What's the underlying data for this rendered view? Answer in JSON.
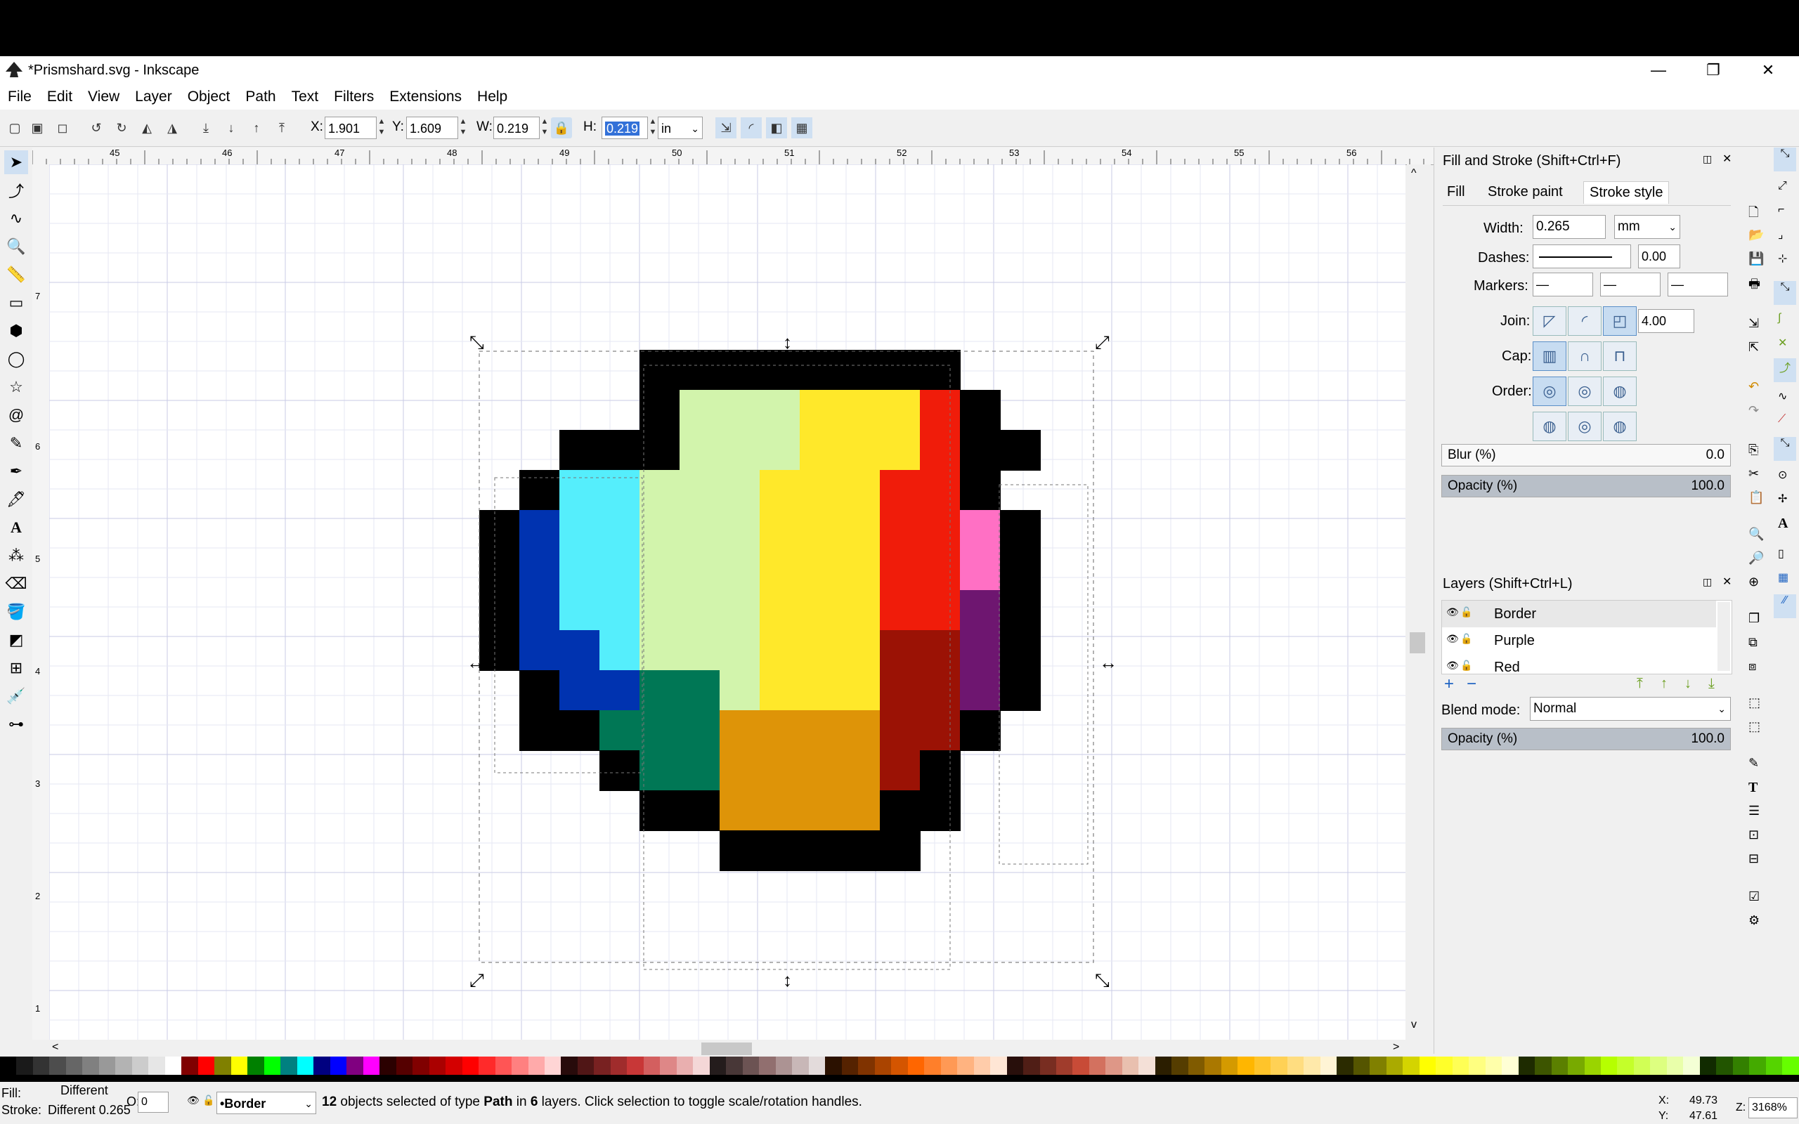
{
  "window": {
    "title": "*Prismshard.svg - Inkscape",
    "minimize_glyph": "—",
    "restore_glyph": "❐",
    "close_glyph": "✕"
  },
  "menu": [
    "File",
    "Edit",
    "View",
    "Layer",
    "Object",
    "Path",
    "Text",
    "Filters",
    "Extensions",
    "Help"
  ],
  "toolbar": {
    "x_label": "X:",
    "x_value": "1.901",
    "y_label": "Y:",
    "y_value": "1.609",
    "w_label": "W:",
    "w_value": "0.219",
    "h_label": "H:",
    "h_value": "0.219",
    "unit": "in"
  },
  "ruler": {
    "h_ticks": [
      "45",
      "46",
      "47",
      "48",
      "49",
      "50",
      "51",
      "52",
      "53",
      "54",
      "55",
      "56"
    ],
    "v_ticks": [
      "7",
      "6",
      "5",
      "4",
      "3",
      "2",
      "1"
    ]
  },
  "fill_stroke": {
    "title": "Fill and Stroke (Shift+Ctrl+F)",
    "tabs": [
      "Fill",
      "Stroke paint",
      "Stroke style"
    ],
    "width_label": "Width:",
    "width_value": "0.265",
    "width_unit": "mm",
    "dashes_label": "Dashes:",
    "dash_offset": "0.00",
    "markers_label": "Markers:",
    "join_label": "Join:",
    "miter_value": "4.00",
    "cap_label": "Cap:",
    "order_label": "Order:",
    "blur_label": "Blur (%)",
    "blur_value": "0.0",
    "opacity_label": "Opacity (%)",
    "opacity_value": "100.0"
  },
  "layers": {
    "title": "Layers (Shift+Ctrl+L)",
    "items": [
      "Border",
      "Purple",
      "Red"
    ],
    "blend_label": "Blend mode:",
    "blend_value": "Normal",
    "opacity_label": "Opacity (%)",
    "opacity_value": "100.0"
  },
  "status": {
    "fill_label": "Fill:",
    "fill_value": "Different",
    "stroke_label": "Stroke:",
    "stroke_value": "Different 0.265",
    "opacity_label": "O:",
    "opacity_value": "0",
    "layer": "•Border",
    "msg_count": "12",
    "msg_a": " objects selected of type ",
    "msg_type": "Path",
    "msg_b": " in ",
    "msg_layers": "6",
    "msg_c": " layers. Click selection to toggle scale/rotation handles.",
    "x_label": "X:",
    "x_value": "49.73",
    "y_label": "Y:",
    "y_value": "47.61",
    "zoom_label": "Z:",
    "zoom_value": "3168%"
  },
  "colors": {
    "highlight": "#13aadf",
    "blue_dark": "#0033b0",
    "cyan": "#55eefc",
    "pale_green": "#d2f4ac",
    "yellow": "#ffe82a",
    "red": "#f01c0a",
    "pink": "#ff70c4",
    "purple": "#6e1670",
    "dark_red": "#9b1205",
    "orange": "#de9408",
    "teal": "#007755",
    "border": "#000000"
  },
  "palette": [
    "#000000",
    "#1a1a1a",
    "#333333",
    "#4d4d4d",
    "#666666",
    "#808080",
    "#999999",
    "#b3b3b3",
    "#cccccc",
    "#e6e6e6",
    "#ffffff",
    "#800000",
    "#ff0000",
    "#808000",
    "#ffff00",
    "#008000",
    "#00ff00",
    "#008080",
    "#00ffff",
    "#000080",
    "#0000ff",
    "#800080",
    "#ff00ff",
    "#2b0000",
    "#550000",
    "#800000",
    "#aa0000",
    "#d40000",
    "#ff0000",
    "#ff2a2a",
    "#ff5555",
    "#ff8080",
    "#ffaaaa",
    "#ffd5d5",
    "#280b0b",
    "#501616",
    "#782121",
    "#a02c2c",
    "#c83737",
    "#d35f5f",
    "#de8787",
    "#e9afaf",
    "#f4d7d7",
    "#241c1c",
    "#483737",
    "#6c5353",
    "#916f6f",
    "#ac9393",
    "#c8b7b7",
    "#e3dbdb",
    "#2b1100",
    "#552200",
    "#803300",
    "#aa4400",
    "#d45500",
    "#ff6600",
    "#ff7f2a",
    "#ff9955",
    "#ffb380",
    "#ffccaa",
    "#ffe6d5",
    "#280f0b",
    "#501e16",
    "#782d21",
    "#a03c2c",
    "#c84b37",
    "#d3715f",
    "#de9787",
    "#e9c0af",
    "#f4e0d7",
    "#2b1e00",
    "#553d00",
    "#805b00",
    "#aa7800",
    "#d49a00",
    "#ffb600",
    "#ffc42a",
    "#ffd155",
    "#ffdd80",
    "#ffe9aa",
    "#fff4d5",
    "#2b2b00",
    "#555500",
    "#808000",
    "#aaaa00",
    "#d4d400",
    "#ffff00",
    "#ffff2a",
    "#ffff55",
    "#ffff80",
    "#ffffaa",
    "#ffffd5",
    "#1e2b00",
    "#3d5500",
    "#5b8000",
    "#78aa00",
    "#9ad400",
    "#b6ff00",
    "#c4ff2a",
    "#d1ff55",
    "#ddff80",
    "#e9ffaa",
    "#f4ffd5",
    "#112b00",
    "#225500",
    "#338000",
    "#44aa00",
    "#55d400",
    "#66ff00"
  ],
  "pixel_art": {
    "cell_colors": {
      "K": "#000000",
      "B": "#0033b0",
      "C": "#55eefc",
      "G": "#d2f4ac",
      "Y": "#ffe82a",
      "R": "#f01c0a",
      "P": "#ff70c4",
      "U": "#6e1670",
      "D": "#9b1205",
      "O": "#de9408",
      "T": "#007755"
    },
    "rows": [
      "...............",
      "...............",
      "....KKKKKKKK...",
      "....KGGGYYYRK..",
      "..KKKGGGYYYRKK.",
      ".KCCGGGYYYRRK..",
      "KBCCGGGYYYRRPK.",
      "KBCCGGGYYYRRPK.",
      "KBCCGGGYYYRRUK.",
      "KBBCGGGYYYDDUK.",
      ".KBBTTGYYYDDUK.",
      ".KKTTTOOOODDK..",
      "...KTTOOOODK...",
      "....KKOOOOKK...",
      "......KKKKK...."
    ]
  }
}
